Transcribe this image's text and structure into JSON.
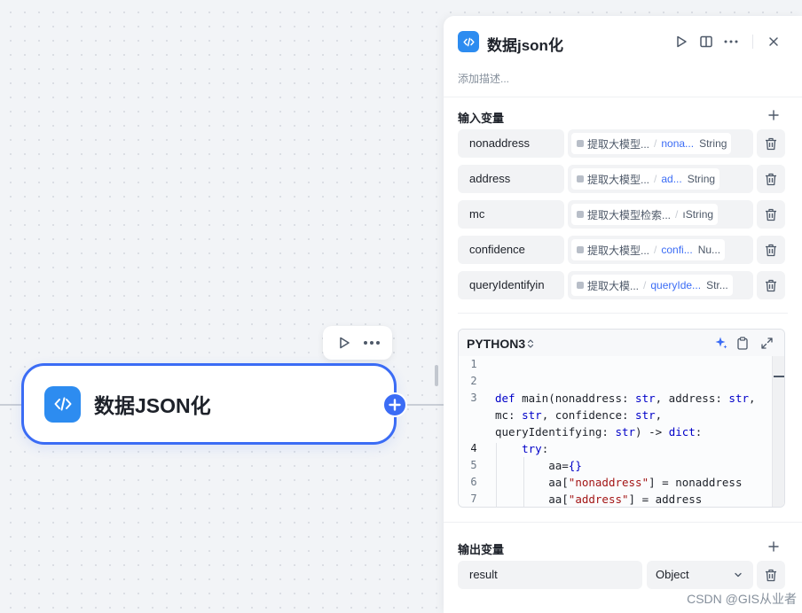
{
  "canvas": {
    "node": {
      "title": "数据JSON化"
    }
  },
  "panel": {
    "title": "数据json化",
    "description_placeholder": "添加描述...",
    "inputs": {
      "title": "输入变量",
      "rows": [
        {
          "name": "nonaddress",
          "ref_node": "提取大模型...",
          "ref_var": "nona...",
          "type": "String"
        },
        {
          "name": "address",
          "ref_node": "提取大模型...",
          "ref_var": "ad...",
          "type": "String"
        },
        {
          "name": "mc",
          "ref_node": "提取大模型检索...",
          "ref_var": "ı",
          "type": "String"
        },
        {
          "name": "confidence",
          "ref_node": "提取大模型...",
          "ref_var": "confi...",
          "type": "Nu..."
        },
        {
          "name": "queryIdentifyin",
          "ref_node": "提取大模...",
          "ref_var": "queryIde...",
          "type": "Str..."
        }
      ]
    },
    "code": {
      "language": "PYTHON3",
      "line_numbers": [
        "1",
        "2",
        "3",
        "",
        "",
        "4",
        "5",
        "6",
        "7"
      ]
    },
    "outputs": {
      "title": "输出变量",
      "rows": [
        {
          "name": "result",
          "type": "Object"
        }
      ]
    }
  },
  "watermark": "CSDN @GIS从业者",
  "colors": {
    "accent": "#3b6cf5",
    "node_icon": "#2d8cf0"
  }
}
